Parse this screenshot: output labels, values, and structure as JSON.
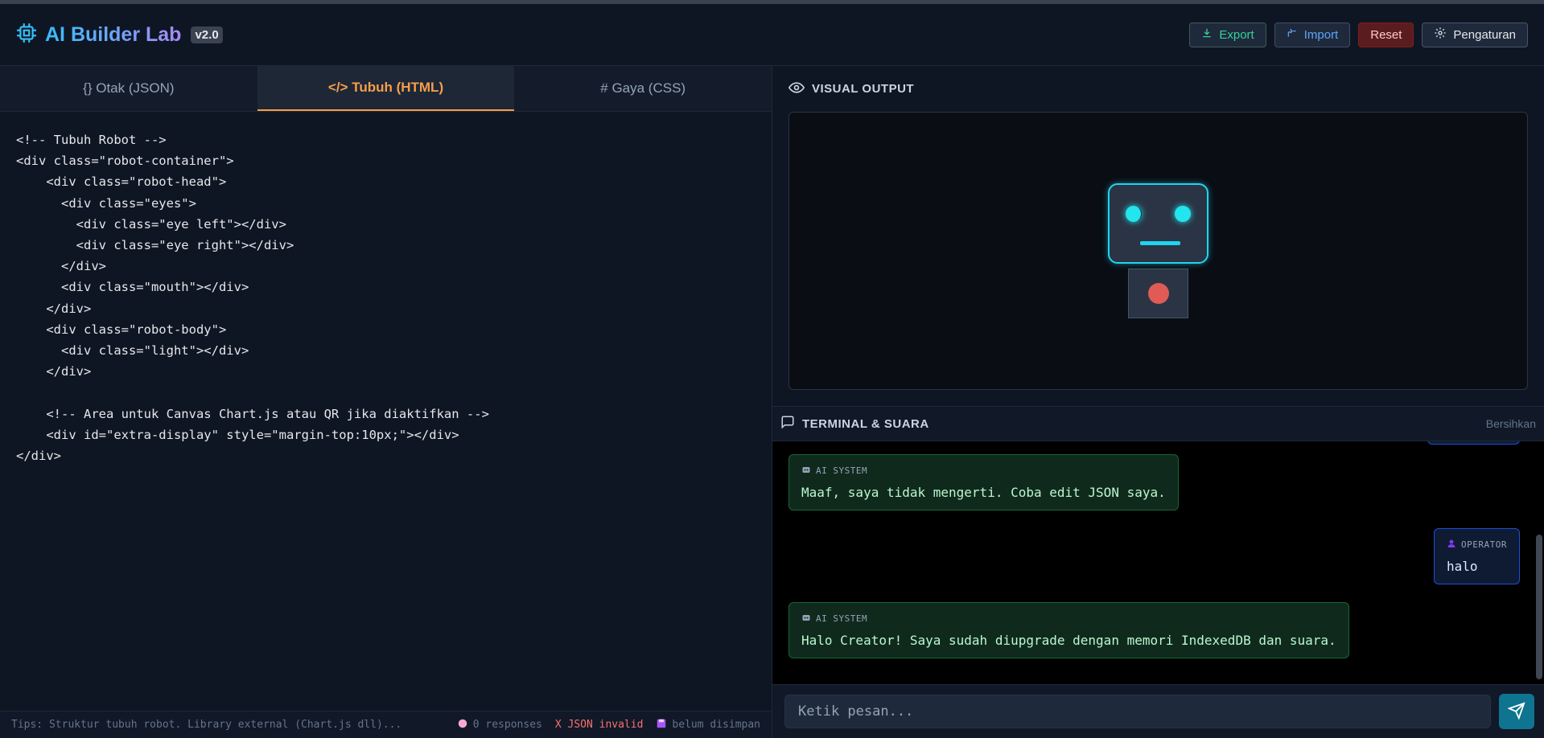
{
  "header": {
    "title": "AI Builder Lab",
    "version": "v2.0",
    "buttons": {
      "export": "Export",
      "import": "Import",
      "reset": "Reset",
      "settings": "Pengaturan"
    }
  },
  "editor": {
    "tabs": [
      "{} Otak (JSON)",
      "</> Tubuh (HTML)",
      "# Gaya (CSS)"
    ],
    "active_tab": 1,
    "code": "<!-- Tubuh Robot -->\n<div class=\"robot-container\">\n    <div class=\"robot-head\">\n      <div class=\"eyes\">\n        <div class=\"eye left\"></div>\n        <div class=\"eye right\"></div>\n      </div>\n      <div class=\"mouth\"></div>\n    </div>\n    <div class=\"robot-body\">\n      <div class=\"light\"></div>\n    </div>\n\n    <!-- Area untuk Canvas Chart.js atau QR jika diaktifkan -->\n    <div id=\"extra-display\" style=\"margin-top:10px;\"></div>\n</div>"
  },
  "statusbar": {
    "tips": "Tips: Struktur tubuh robot. Library external (Chart.js dll)...",
    "responses": "0 responses",
    "json_status": "X JSON invalid",
    "save_status": "belum disimpan"
  },
  "visual": {
    "title": "VISUAL OUTPUT"
  },
  "terminal": {
    "title": "TERMINAL & SUARA",
    "clear_label": "Bersihkan",
    "messages": [
      {
        "role": "ai",
        "label": "AI SYSTEM",
        "text": "Maaf, saya tidak mengerti. Coba edit JSON saya."
      },
      {
        "role": "user",
        "label": "OPERATOR",
        "text": "halo"
      },
      {
        "role": "ai",
        "label": "AI SYSTEM",
        "text": "Halo Creator! Saya sudah diupgrade dengan memori IndexedDB dan suara."
      }
    ]
  },
  "input": {
    "placeholder": "Ketik pesan..."
  },
  "colors": {
    "accent": "#f59e4b",
    "cyan": "#22d3ee",
    "ai_bubble": "#0f2a1c",
    "user_bubble": "#0f1b33",
    "error": "#f87171"
  }
}
